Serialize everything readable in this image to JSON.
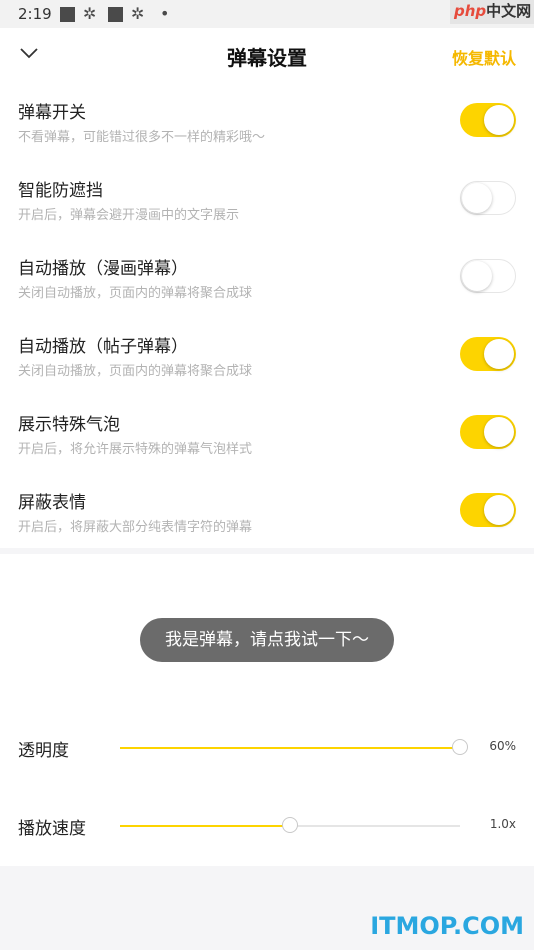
{
  "status_bar": {
    "time": "2:19"
  },
  "watermark": {
    "top_php": "php",
    "top_cn": "中文网",
    "bottom": "ITMOP.COM"
  },
  "header": {
    "title": "弹幕设置",
    "reset_label": "恢复默认"
  },
  "settings": [
    {
      "label": "弹幕开关",
      "desc": "不看弹幕，可能错过很多不一样的精彩哦～",
      "on": true
    },
    {
      "label": "智能防遮挡",
      "desc": "开启后，弹幕会避开漫画中的文字展示",
      "on": false
    },
    {
      "label": "自动播放（漫画弹幕）",
      "desc": "关闭自动播放，页面内的弹幕将聚合成球",
      "on": false
    },
    {
      "label": "自动播放（帖子弹幕）",
      "desc": "关闭自动播放，页面内的弹幕将聚合成球",
      "on": true
    },
    {
      "label": "展示特殊气泡",
      "desc": "开启后，将允许展示特殊的弹幕气泡样式",
      "on": true
    },
    {
      "label": "屏蔽表情",
      "desc": "开启后，将屏蔽大部分纯表情字符的弹幕",
      "on": true
    }
  ],
  "preview": {
    "bubble_text": "我是弹幕，请点我试一下～"
  },
  "sliders": [
    {
      "label": "透明度",
      "value_text": "60%",
      "fraction": 1.0
    },
    {
      "label": "播放速度",
      "value_text": "1.0x",
      "fraction": 0.5
    }
  ],
  "colors": {
    "accent": "#fdd400",
    "reset": "#f5b800"
  },
  "icons": {
    "back": "chevron-down-icon"
  }
}
